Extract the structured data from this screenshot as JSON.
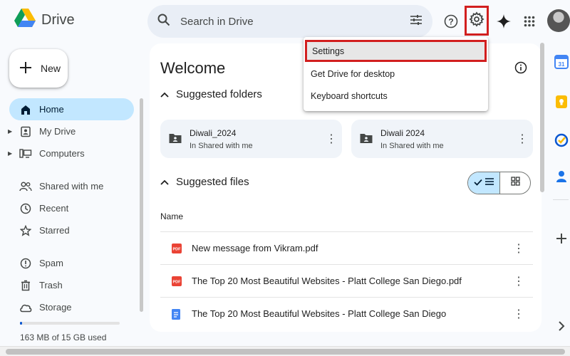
{
  "app": {
    "name": "Drive"
  },
  "search": {
    "placeholder": "Search in Drive"
  },
  "sidebar": {
    "new_label": "New",
    "items": [
      {
        "label": "Home",
        "icon": "home-icon"
      },
      {
        "label": "My Drive",
        "icon": "my-drive-icon"
      },
      {
        "label": "Computers",
        "icon": "computers-icon"
      },
      {
        "label": "Shared with me",
        "icon": "shared-icon"
      },
      {
        "label": "Recent",
        "icon": "clock-icon"
      },
      {
        "label": "Starred",
        "icon": "star-icon"
      },
      {
        "label": "Spam",
        "icon": "spam-icon"
      },
      {
        "label": "Trash",
        "icon": "trash-icon"
      },
      {
        "label": "Storage",
        "icon": "cloud-icon"
      }
    ],
    "storage_text": "163 MB of 15 GB used",
    "storage_fraction": 0.011
  },
  "main": {
    "title": "Welcome",
    "suggested_folders_label": "Suggested folders",
    "folders": [
      {
        "name": "Diwali_2024",
        "subtitle": "In Shared with me"
      },
      {
        "name": "Diwali 2024",
        "subtitle": "In Shared with me"
      }
    ],
    "suggested_files_label": "Suggested files",
    "name_column": "Name",
    "files": [
      {
        "name": "New message from Vikram.pdf",
        "type": "pdf"
      },
      {
        "name": "The Top 20 Most Beautiful Websites - Platt College San Diego.pdf",
        "type": "pdf"
      },
      {
        "name": "The Top 20 Most Beautiful Websites - Platt College San Diego",
        "type": "doc"
      }
    ]
  },
  "settings_menu": {
    "items": [
      {
        "label": "Settings"
      },
      {
        "label": "Get Drive for desktop"
      },
      {
        "label": "Keyboard shortcuts"
      }
    ]
  },
  "colors": {
    "accent": "#0b57d0",
    "active_nav": "#c2e7ff",
    "highlight_border": "#d21f1f",
    "pdf_red": "#ea4335",
    "doc_blue": "#4285f4"
  }
}
